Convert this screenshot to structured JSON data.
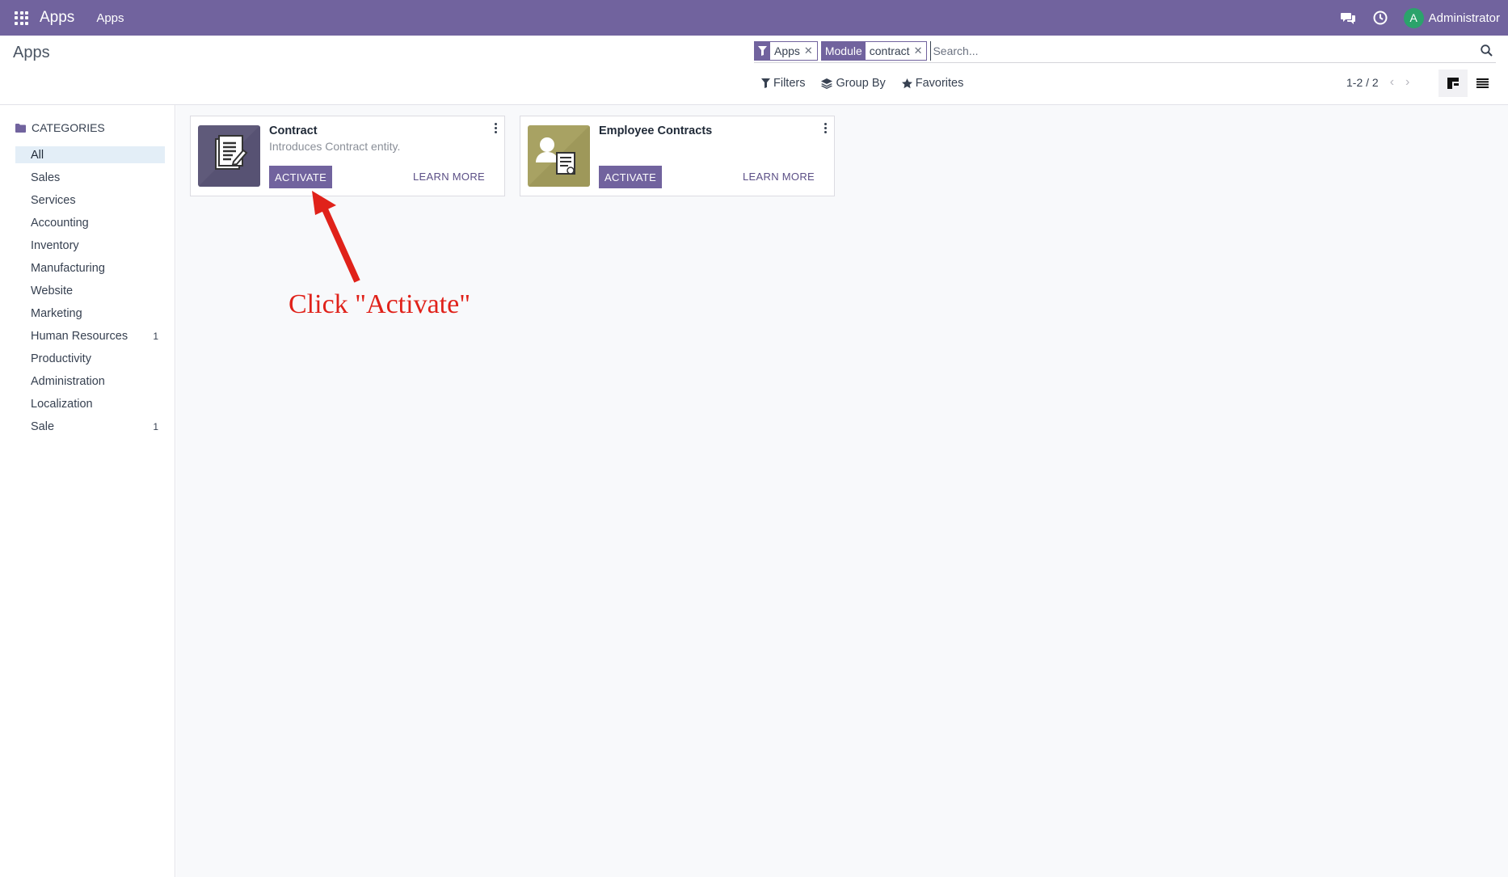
{
  "navbar": {
    "brand": "Apps",
    "menu_item": "Apps",
    "avatar_initial": "A",
    "user_name": "Administrator",
    "color": "#71639e",
    "icons": [
      "apps-grid-icon",
      "chat-icon",
      "clock-icon"
    ]
  },
  "control_panel": {
    "breadcrumb": "Apps",
    "search": {
      "facets": [
        {
          "label_icon": "filter-icon",
          "value": "Apps"
        },
        {
          "label": "Module",
          "value": "contract"
        }
      ],
      "placeholder": "Search..."
    },
    "filters_label": "Filters",
    "group_by_label": "Group By",
    "favorites_label": "Favorites",
    "pager": "1-2 / 2"
  },
  "sidebar": {
    "header": "CATEGORIES",
    "items": [
      {
        "label": "All",
        "count": ""
      },
      {
        "label": "Sales",
        "count": ""
      },
      {
        "label": "Services",
        "count": ""
      },
      {
        "label": "Accounting",
        "count": ""
      },
      {
        "label": "Inventory",
        "count": ""
      },
      {
        "label": "Manufacturing",
        "count": ""
      },
      {
        "label": "Website",
        "count": ""
      },
      {
        "label": "Marketing",
        "count": ""
      },
      {
        "label": "Human Resources",
        "count": "1"
      },
      {
        "label": "Productivity",
        "count": ""
      },
      {
        "label": "Administration",
        "count": ""
      },
      {
        "label": "Localization",
        "count": ""
      },
      {
        "label": "Sale",
        "count": "1"
      }
    ]
  },
  "cards": [
    {
      "title": "Contract",
      "description": "Introduces Contract entity.",
      "activate": "ACTIVATE",
      "learn_more": "LEARN MORE",
      "icon": "contract-document-icon",
      "icon_color": "#5f5a7a"
    },
    {
      "title": "Employee Contracts",
      "description": "",
      "activate": "ACTIVATE",
      "learn_more": "LEARN MORE",
      "icon": "employee-contract-icon",
      "icon_color": "#a8a263"
    }
  ],
  "annotation": {
    "text": "Click \"Activate\"",
    "color": "#e0221a"
  }
}
